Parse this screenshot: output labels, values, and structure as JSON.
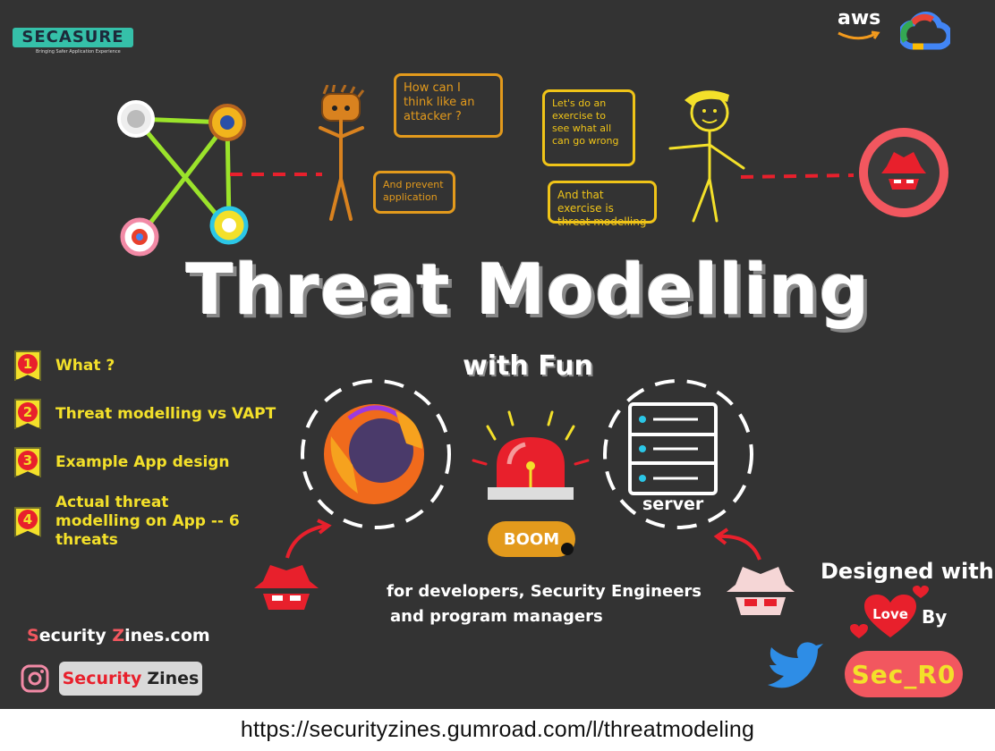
{
  "brand": {
    "logo_text": "SECASURE",
    "logo_tagline": "Bringing Safer Application Experience",
    "cloud_text": "aws"
  },
  "bubbles": {
    "attacker_q": "How can I think like an attacker ?",
    "prevent": "And prevent application",
    "exercise": "Let's do an exercise to see what all can go wrong",
    "exercise_is": "And that exercise is threat modelling"
  },
  "title": "Threat Modelling",
  "subtitle": "with Fun",
  "toc": [
    {
      "num": "1",
      "text": "What ?"
    },
    {
      "num": "2",
      "text": "Threat modelling vs VAPT"
    },
    {
      "num": "3",
      "text": "Example App design"
    },
    {
      "num": "4",
      "text": "Actual threat modelling on App -- 6 threats"
    }
  ],
  "boom": "BOOM",
  "server_label": "server",
  "audience": {
    "line1": "for developers, Security Engineers",
    "line2": "and program managers"
  },
  "site": {
    "first": "S",
    "mid1": "ecurity ",
    "z": "Z",
    "rest": "ines.com"
  },
  "instagram": {
    "first": "Security",
    "second": "Zines"
  },
  "credit": {
    "designed": "Designed with",
    "love": "Love",
    "by": "By",
    "author": "Sec_R0"
  },
  "footer_url": "https://securityzines.gumroad.com/l/threatmodeling",
  "colors": {
    "background": "#333333",
    "orange": "#e39a1c",
    "yellow": "#f3e02a",
    "red": "#e8202c",
    "teal": "#35c0a9"
  }
}
